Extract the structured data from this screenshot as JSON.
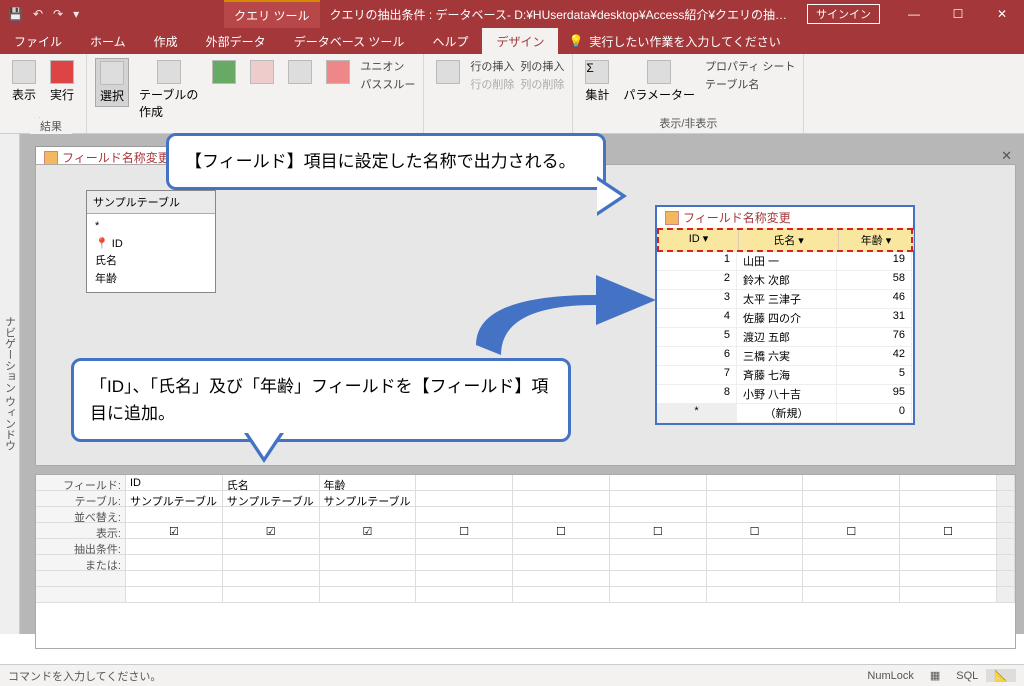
{
  "titlebar": {
    "contextual": "クエリ ツール",
    "title": "クエリの抽出条件 : データベース- D:¥HUserdata¥desktop¥Access紹介¥クエリの抽…",
    "signin": "サインイン"
  },
  "tabs": {
    "file": "ファイル",
    "home": "ホーム",
    "create": "作成",
    "external": "外部データ",
    "dbtools": "データベース ツール",
    "help": "ヘルプ",
    "design": "デザイン",
    "tellme": "実行したい作業を入力してください"
  },
  "ribbon": {
    "view": "表示",
    "run": "実行",
    "results_label": "結果",
    "select": "選択",
    "maketable": "テーブルの\n作成",
    "union": "ユニオン",
    "passthrough": "パススルー",
    "rowinsert": "行の挿入",
    "rowdelete": "行の削除",
    "colinsert": "列の挿入",
    "coldelete": "列の削除",
    "totals": "集計",
    "params": "パラメーター",
    "propsheet": "プロパティ シート",
    "tablenames": "テーブル名",
    "showhide": "表示/非表示"
  },
  "nav_window": "ナビゲーション ウィンドウ",
  "design_tab_name": "フィールド名称変更",
  "table_list": {
    "name": "サンプルテーブル",
    "fields": [
      "*",
      "ID",
      "氏名",
      "年齢"
    ]
  },
  "callout1": "【フィールド】項目に設定した名称で出力される。",
  "callout2": "「ID」、「氏名」及び「年齢」フィールドを【フィールド】項目に追加。",
  "result": {
    "title": "フィールド名称変更",
    "headers": [
      "ID",
      "氏名",
      "年齢"
    ],
    "rows": [
      [
        "1",
        "山田 一",
        "19"
      ],
      [
        "2",
        "鈴木 次郎",
        "58"
      ],
      [
        "3",
        "太平 三津子",
        "46"
      ],
      [
        "4",
        "佐藤 四の介",
        "31"
      ],
      [
        "5",
        "渡辺 五郎",
        "76"
      ],
      [
        "6",
        "三橋 六実",
        "42"
      ],
      [
        "7",
        "斉藤 七海",
        "5"
      ],
      [
        "8",
        "小野 八十吉",
        "95"
      ]
    ],
    "newrow": "（新規）",
    "newval": "0"
  },
  "grid": {
    "labels": {
      "field": "フィールド:",
      "table": "テーブル:",
      "sort": "並べ替え:",
      "show": "表示:",
      "criteria": "抽出条件:",
      "or": "または:"
    },
    "cols": [
      {
        "field": "ID",
        "table": "サンプルテーブル",
        "show": true
      },
      {
        "field": "氏名",
        "table": "サンプルテーブル",
        "show": true
      },
      {
        "field": "年齢",
        "table": "サンプルテーブル",
        "show": true
      },
      {
        "field": "",
        "table": "",
        "show": false
      },
      {
        "field": "",
        "table": "",
        "show": false
      },
      {
        "field": "",
        "table": "",
        "show": false
      },
      {
        "field": "",
        "table": "",
        "show": false
      },
      {
        "field": "",
        "table": "",
        "show": false
      },
      {
        "field": "",
        "table": "",
        "show": false
      }
    ]
  },
  "status": {
    "msg": "コマンドを入力してください。",
    "numlock": "NumLock",
    "sql": "SQL"
  }
}
